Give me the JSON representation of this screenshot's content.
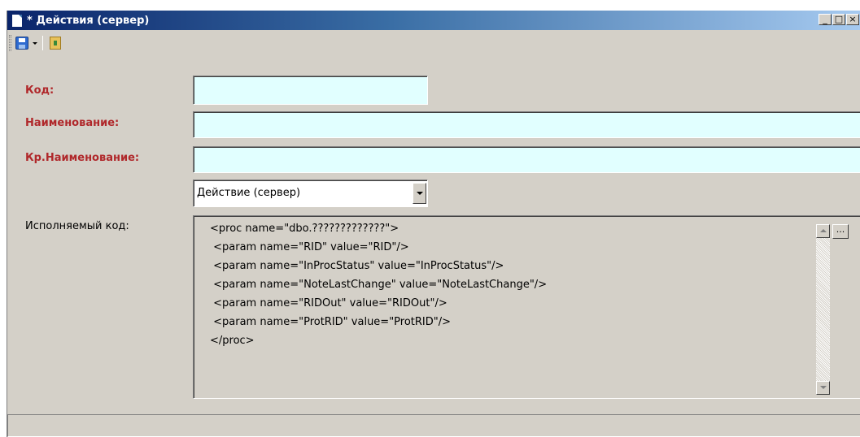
{
  "window": {
    "title": "* Действия (сервер)",
    "minimize_glyph": "_",
    "maximize_glyph": "□",
    "close_glyph": "×"
  },
  "toolbar": {
    "save_icon": "save-floppy-icon",
    "exit_icon": "exit-door-icon"
  },
  "form": {
    "code_label": "Код:",
    "code_value": "",
    "name_label": "Наименование:",
    "name_value": "",
    "short_name_label": "Кр.Наименование:",
    "short_name_value": "",
    "type_selected": "Действие (сервер)",
    "exec_code_label": "Исполняемый код:",
    "exec_code_lines": [
      "<proc name=\"dbo.?????????????\">",
      " <param name=\"RID\" value=\"RID\"/>",
      " <param name=\"InProcStatus\" value=\"InProcStatus\"/>",
      " <param name=\"NoteLastChange\" value=\"NoteLastChange\"/>",
      " <param name=\"RIDOut\" value=\"RIDOut\"/>",
      " <param name=\"ProtRID\" value=\"ProtRID\"/>",
      "</proc>"
    ],
    "ellipsis_label": "..."
  },
  "colors": {
    "required_label": "#b0282b",
    "field_bg": "#e1ffff",
    "window_bg": "#d4d0c8",
    "title_start": "#0a246a"
  }
}
